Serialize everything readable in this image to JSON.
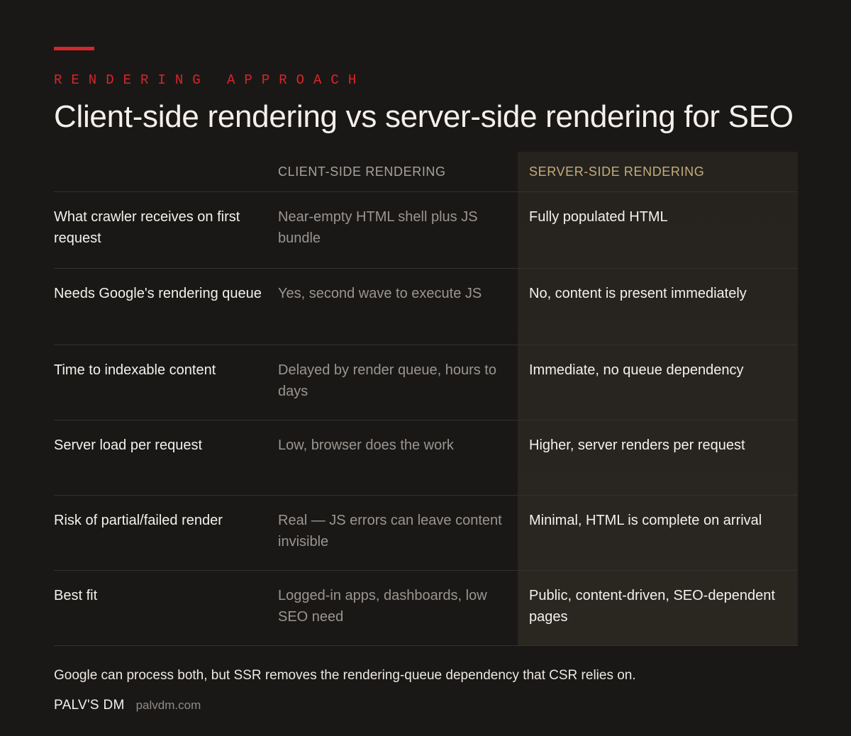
{
  "eyebrow": "RENDERING APPROACH",
  "title": "Client-side rendering vs server-side rendering for SEO",
  "table": {
    "headers": [
      "",
      "CLIENT-SIDE RENDERING",
      "SERVER-SIDE RENDERING"
    ],
    "rows": [
      {
        "label": "What crawler receives on first request",
        "csr": "Near-empty HTML shell plus JS bundle",
        "ssr": "Fully populated HTML"
      },
      {
        "label": "Needs Google's rendering queue",
        "csr": "Yes, second wave to execute JS",
        "ssr": "No, content is present immediately"
      },
      {
        "label": "Time to indexable content",
        "csr": "Delayed by render queue, hours to days",
        "ssr": "Immediate, no queue dependency"
      },
      {
        "label": "Server load per request",
        "csr": "Low, browser does the work",
        "ssr": "Higher, server renders per request"
      },
      {
        "label": "Risk of partial/failed render",
        "csr": "Real — JS errors can leave content invisible",
        "ssr": "Minimal, HTML is complete on arrival"
      },
      {
        "label": "Best fit",
        "csr": "Logged-in apps, dashboards, low SEO need",
        "ssr": "Public, content-driven, SEO-dependent pages"
      }
    ]
  },
  "footnote": "Google can process both, but SSR removes the rendering-queue dependency that CSR relies on.",
  "brand": {
    "name": "PALV'S DM",
    "url": "palvdm.com"
  },
  "colors": {
    "accent": "#d7262a",
    "ssr_header": "#c4ad79",
    "background": "#1a1817"
  }
}
